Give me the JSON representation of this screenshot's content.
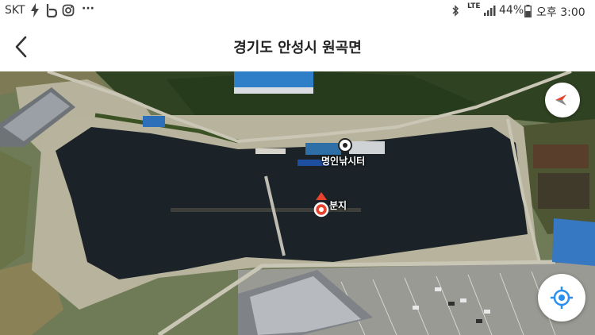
{
  "status_bar": {
    "carrier": "SKT",
    "notification_icons": [
      "bolt-icon",
      "b-app-icon",
      "instagram-icon",
      "more-dots-icon"
    ],
    "more": "···",
    "network": "LTE",
    "battery_percent": "44%",
    "time": "오후 3:00"
  },
  "header": {
    "title": "경기도 안성시 원곡면",
    "back_icon": "chevron-left-icon"
  },
  "map": {
    "pois": [
      {
        "label": "명인낚시터",
        "icon": "target-icon"
      },
      {
        "label": "분지",
        "icon": "map-pin-icon"
      }
    ],
    "pin_color": "#e8432e",
    "water_color": "#1b2328"
  },
  "controls": {
    "compass_icon": "compass-icon",
    "locate_icon": "my-location-icon",
    "accent": "#2b8ff0"
  }
}
